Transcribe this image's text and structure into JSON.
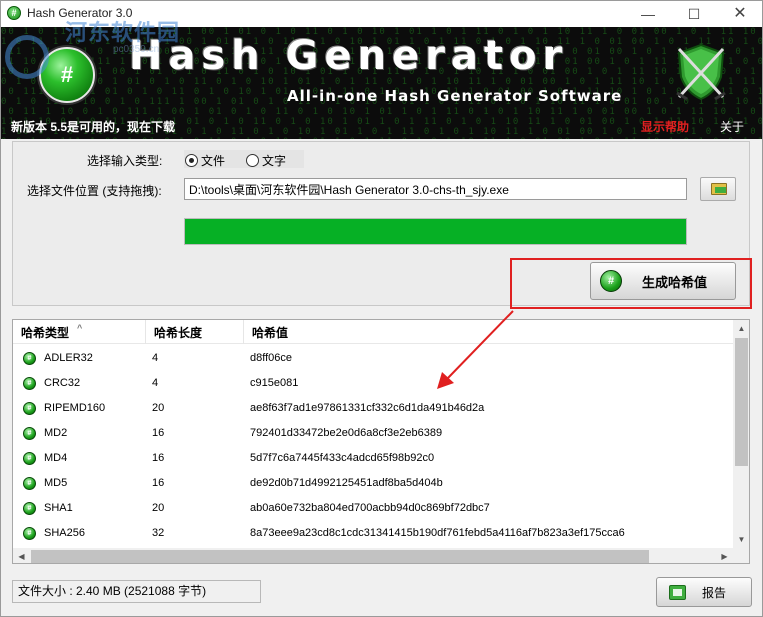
{
  "window": {
    "title": "Hash Generator 3.0",
    "controls": {
      "minimize": "—",
      "maximize": "☐",
      "close": "✕"
    }
  },
  "watermark": {
    "text": "河东软件园",
    "sub": "pc0359.cn"
  },
  "banner": {
    "title": "Hash Generator",
    "subtitle": "All-in-one Hash Generator Software",
    "update_notice": "新版本 5.5是可用的，现在下载",
    "help_link": "显示帮助",
    "about_link": "关于",
    "logo_glyph": "#",
    "matrix_text": "00 1 0 11 1 10 0 1 0 111 1 00 1 01 0 1 0 11 0 1 0 10 1 01 1 0 1 11 0 1 0 1 10 11 1 0 01 00 1 0 1 11 10 1 0 1 0 0 1 11 0 1 0 1 01 1 10 0 1 0"
  },
  "input": {
    "type_label": "选择输入类型:",
    "radio_file": "文件",
    "radio_text": "文字",
    "selected": "file",
    "location_label": "选择文件位置 (支持拖拽):",
    "path_value": "D:\\tools\\桌面\\河东软件园\\Hash Generator 3.0-chs-th_sjy.exe",
    "progress_percent": 100,
    "generate_button": "生成哈希值",
    "generate_icon": "#"
  },
  "table": {
    "headers": [
      "哈希类型",
      "哈希长度",
      "哈希值"
    ],
    "sort_indicator": "^",
    "rows": [
      {
        "type": "ADLER32",
        "length": "4",
        "value": "d8ff06ce"
      },
      {
        "type": "CRC32",
        "length": "4",
        "value": "c915e081"
      },
      {
        "type": "RIPEMD160",
        "length": "20",
        "value": "ae8f63f7ad1e97861331cf332c6d1da491b46d2a"
      },
      {
        "type": "MD2",
        "length": "16",
        "value": "792401d33472be2e0d6a8cf3e2eb6389"
      },
      {
        "type": "MD4",
        "length": "16",
        "value": "5d7f7c6a7445f433c4adcd65f98b92c0"
      },
      {
        "type": "MD5",
        "length": "16",
        "value": "de92d0b71d4992125451adf8ba5d404b"
      },
      {
        "type": "SHA1",
        "length": "20",
        "value": "ab0a60e732ba804ed700acbb94d0c869bf72dbc7"
      },
      {
        "type": "SHA256",
        "length": "32",
        "value": "8a73eee9a23cd8c1cdc31341415b190df761febd5a4116af7b823a3ef175cca6"
      }
    ],
    "row_icon": "#",
    "scroll": {
      "up": "▲",
      "down": "▼",
      "left": "◀",
      "right": "▶"
    }
  },
  "status": {
    "file_size": "文件大小 : 2.40 MB (2521088 字节)"
  },
  "report_button": "报告",
  "colors": {
    "accent_green": "#06b025",
    "highlight_red": "#e02020",
    "banner_bg": "#0c0c0c"
  }
}
